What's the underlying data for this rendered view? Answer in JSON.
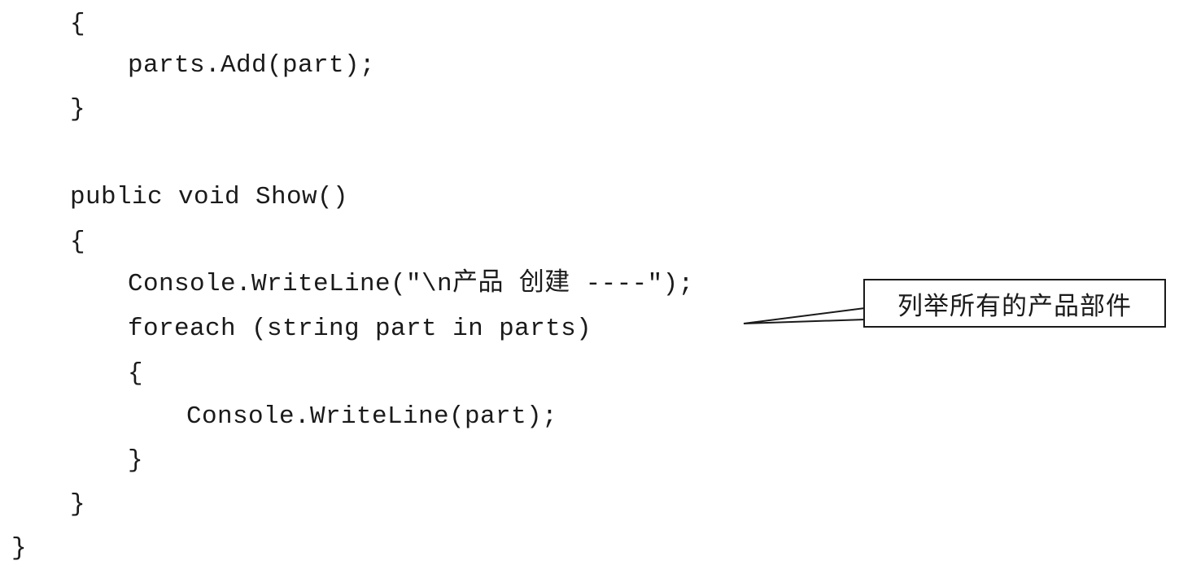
{
  "code": {
    "lines": [
      "{",
      "parts.Add(part);",
      "}",
      "public void Show()",
      "{",
      "Console.WriteLine(\"\\n产品 创建 ----\");",
      "foreach (string part in parts)",
      "{",
      "Console.WriteLine(part);",
      "}",
      "}",
      "}"
    ]
  },
  "callout": {
    "text": "列举所有的产品部件"
  }
}
